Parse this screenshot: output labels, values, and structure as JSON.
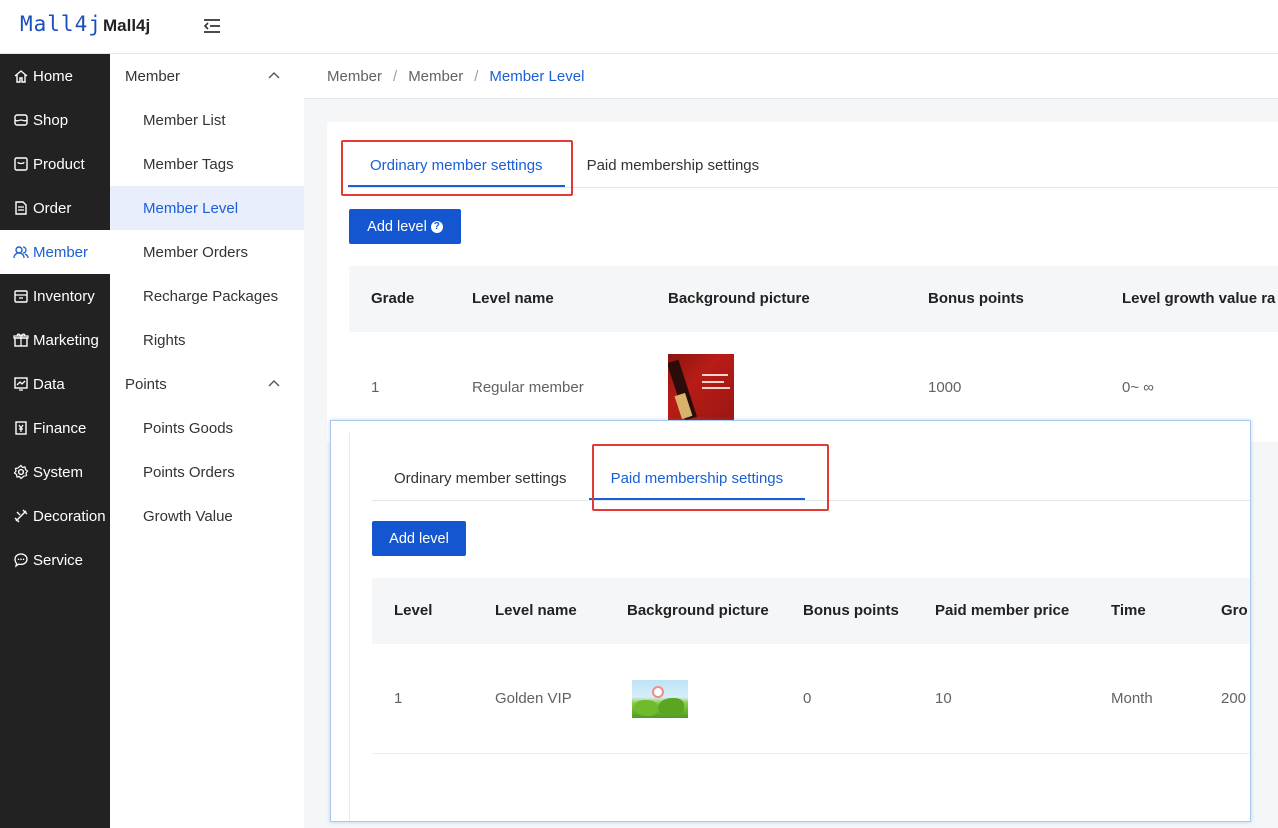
{
  "header": {
    "logo_text": "Mall4j",
    "app_name": "Mall4j"
  },
  "nav": {
    "items": [
      {
        "label": "Home",
        "icon": "home-icon"
      },
      {
        "label": "Shop",
        "icon": "shop-icon"
      },
      {
        "label": "Product",
        "icon": "product-icon"
      },
      {
        "label": "Order",
        "icon": "order-icon"
      },
      {
        "label": "Member",
        "icon": "member-icon",
        "active": true
      },
      {
        "label": "Inventory",
        "icon": "inventory-icon"
      },
      {
        "label": "Marketing",
        "icon": "gift-icon"
      },
      {
        "label": "Data",
        "icon": "chart-icon"
      },
      {
        "label": "Finance",
        "icon": "finance-icon"
      },
      {
        "label": "System",
        "icon": "gear-icon"
      },
      {
        "label": "Decoration",
        "icon": "decoration-icon"
      },
      {
        "label": "Service",
        "icon": "chat-icon"
      }
    ]
  },
  "submenu": {
    "groups": [
      {
        "title": "Member",
        "items": [
          "Member List",
          "Member Tags",
          "Member Level",
          "Member Orders",
          "Recharge Packages",
          "Rights"
        ]
      },
      {
        "title": "Points",
        "items": [
          "Points Goods",
          "Points Orders",
          "Growth Value"
        ]
      }
    ],
    "active_item": "Member Level"
  },
  "breadcrumb": [
    "Member",
    "Member",
    "Member Level"
  ],
  "ordinary_panel": {
    "tabs": [
      "Ordinary member settings",
      "Paid membership settings"
    ],
    "active_tab": 0,
    "add_button": "Add level",
    "add_button_help": "?",
    "columns": [
      "Grade",
      "Level name",
      "Background picture",
      "Bonus points",
      "Level growth value ra"
    ],
    "rows": [
      {
        "grade": "1",
        "level_name": "Regular member",
        "bonus_points": "1000",
        "growth_range": "0~ ∞"
      }
    ]
  },
  "paid_panel": {
    "tabs": [
      "Ordinary member settings",
      "Paid membership settings"
    ],
    "active_tab": 1,
    "add_button": "Add level",
    "columns": [
      "Level",
      "Level name",
      "Background picture",
      "Bonus points",
      "Paid member price",
      "Time",
      "Gro"
    ],
    "rows": [
      {
        "level": "1",
        "level_name": "Golden VIP",
        "bonus_points": "0",
        "price": "10",
        "time": "Month",
        "growth": "200"
      }
    ]
  },
  "colors": {
    "accent": "#1a5fd6",
    "button": "#1456d0",
    "sidebar": "#222222",
    "highlight_box": "#e53935"
  }
}
